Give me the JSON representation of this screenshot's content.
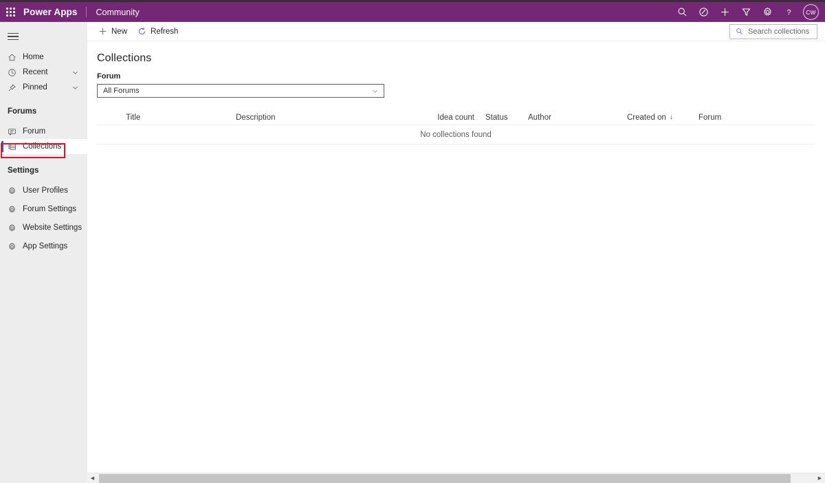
{
  "header": {
    "waffle_label": "app-launcher",
    "brand": "Power Apps",
    "app_name": "Community",
    "brand_color": "#742774",
    "icons": [
      {
        "name": "search-icon",
        "label": "Search"
      },
      {
        "name": "environment-icon",
        "label": "Environment"
      },
      {
        "name": "add-icon",
        "label": "New"
      },
      {
        "name": "filter-icon",
        "label": "Filter"
      },
      {
        "name": "settings-gear-icon",
        "label": "Settings"
      },
      {
        "name": "help-icon",
        "label": "Help"
      }
    ],
    "avatar_initials": "CW"
  },
  "sidebar": {
    "hamburger_label": "Menu",
    "nav": [
      {
        "label": "Home",
        "icon": "home-icon",
        "chevron": false
      },
      {
        "label": "Recent",
        "icon": "clock-icon",
        "chevron": true
      },
      {
        "label": "Pinned",
        "icon": "pin-icon",
        "chevron": true
      }
    ],
    "groups": [
      {
        "title": "Forums",
        "items": [
          {
            "label": "Forum",
            "icon": "comment-icon",
            "selected": false
          },
          {
            "label": "Collections",
            "icon": "list-icon",
            "selected": true
          }
        ]
      },
      {
        "title": "Settings",
        "items": [
          {
            "label": "User Profiles",
            "icon": "gear-icon",
            "selected": false
          },
          {
            "label": "Forum Settings",
            "icon": "gear-icon",
            "selected": false
          },
          {
            "label": "Website Settings",
            "icon": "gear-icon",
            "selected": false
          },
          {
            "label": "App Settings",
            "icon": "gear-icon",
            "selected": false
          }
        ]
      }
    ],
    "highlight_color": "#e81123",
    "selected_indicator_color": "#2266cc"
  },
  "commandbar": {
    "new_label": "New",
    "refresh_label": "Refresh",
    "search_placeholder": "Search collections",
    "accent_color": "#5c6bc0"
  },
  "page": {
    "title": "Collections",
    "filter_label": "Forum",
    "filter_value": "All Forums"
  },
  "grid": {
    "columns": [
      {
        "label": "Title",
        "sort": ""
      },
      {
        "label": "Description",
        "sort": ""
      },
      {
        "label": "Idea count",
        "sort": ""
      },
      {
        "label": "Status",
        "sort": ""
      },
      {
        "label": "Author",
        "sort": ""
      },
      {
        "label": "Created on",
        "sort": "↓"
      },
      {
        "label": "Forum",
        "sort": ""
      }
    ],
    "rows": [],
    "empty_message": "No collections found"
  },
  "scrollbar": {
    "left_arrow": "◀",
    "right_arrow": "▶"
  }
}
